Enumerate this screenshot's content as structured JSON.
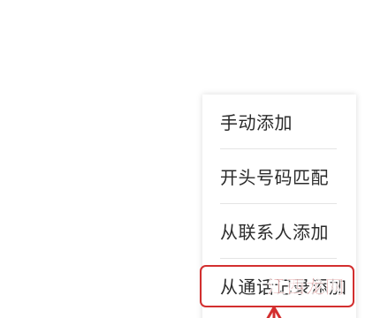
{
  "menu": {
    "items": [
      {
        "label": "手动添加"
      },
      {
        "label": "开头号码匹配"
      },
      {
        "label": "从联系人添加"
      },
      {
        "label": "从通话记录添加"
      }
    ]
  },
  "annotation": {
    "highlight_color": "#d32f2f",
    "pointer": "arrow-up-icon"
  },
  "watermark": {
    "text": "江西龙网",
    "color": "#c62828"
  }
}
